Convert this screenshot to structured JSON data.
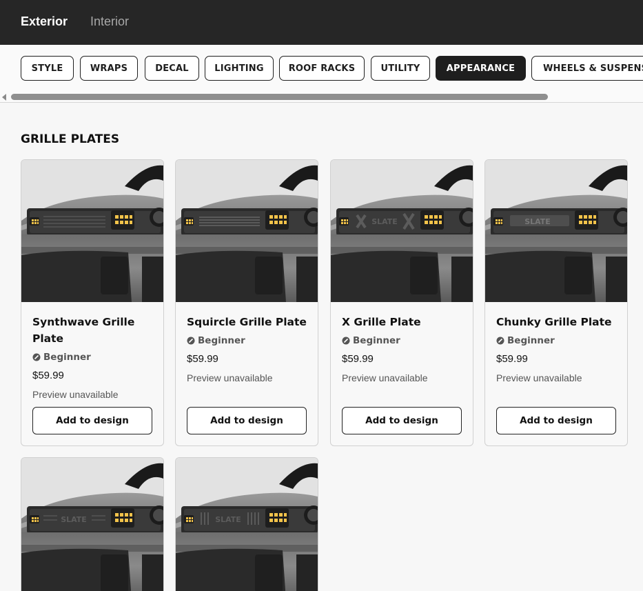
{
  "header": {
    "tabs": [
      {
        "label": "Exterior",
        "active": true
      },
      {
        "label": "Interior",
        "active": false
      }
    ]
  },
  "categories": {
    "items": [
      {
        "label": "STYLE",
        "active": false
      },
      {
        "label": "WRAPS",
        "active": false
      },
      {
        "label": "DECAL",
        "active": false
      },
      {
        "label": "LIGHTING",
        "active": false
      },
      {
        "label": "ROOF RACKS",
        "active": false
      },
      {
        "label": "UTILITY",
        "active": false
      },
      {
        "label": "APPEARANCE",
        "active": true
      },
      {
        "label": "WHEELS & SUSPENSI",
        "active": false
      }
    ]
  },
  "section": {
    "title": "GRILLE PLATES"
  },
  "products": [
    {
      "title": "Synthwave Grille Plate",
      "level": "Beginner",
      "price": "$59.99",
      "preview": "Preview unavailable",
      "button": "Add to design",
      "grille": "synthwave"
    },
    {
      "title": "Squircle Grille Plate",
      "level": "Beginner",
      "price": "$59.99",
      "preview": "Preview unavailable",
      "button": "Add to design",
      "grille": "squircle"
    },
    {
      "title": "X Grille Plate",
      "level": "Beginner",
      "price": "$59.99",
      "preview": "Preview unavailable",
      "button": "Add to design",
      "grille": "x",
      "plate_text": "SLATE"
    },
    {
      "title": "Chunky Grille Plate",
      "level": "Beginner",
      "price": "$59.99",
      "preview": "Preview unavailable",
      "button": "Add to design",
      "grille": "chunky",
      "plate_text": "SLATE"
    },
    {
      "grille": "lined",
      "plate_text": "SLATE"
    },
    {
      "grille": "vertical",
      "plate_text": "SLATE"
    }
  ],
  "colors": {
    "dark": "#262626",
    "light_bg": "#f7f7f7",
    "amber": "#f3c34a",
    "muted": "#555555"
  }
}
